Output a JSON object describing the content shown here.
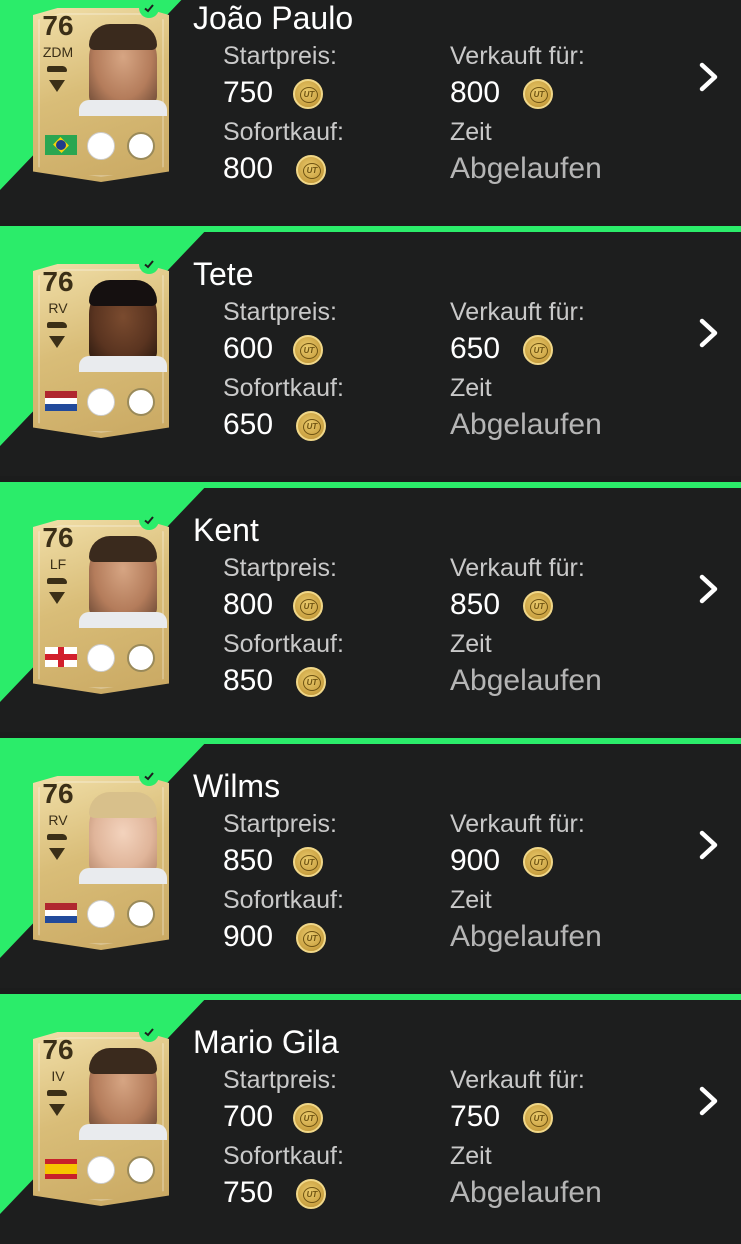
{
  "labels": {
    "start_price": "Startpreis:",
    "buy_now": "Sofortkauf:",
    "sold_for": "Verkauft für:",
    "time": "Zeit",
    "expired": "Abgelaufen"
  },
  "coin_text": "UT",
  "items": [
    {
      "name": "João Paulo",
      "rating": "76",
      "position": "ZDM",
      "start_price": "750",
      "buy_now": "800",
      "sold_for": "800"
    },
    {
      "name": "Tete",
      "rating": "76",
      "position": "RV",
      "start_price": "600",
      "buy_now": "650",
      "sold_for": "650"
    },
    {
      "name": "Kent",
      "rating": "76",
      "position": "LF",
      "start_price": "800",
      "buy_now": "850",
      "sold_for": "850"
    },
    {
      "name": "Wilms",
      "rating": "76",
      "position": "RV",
      "start_price": "850",
      "buy_now": "900",
      "sold_for": "900"
    },
    {
      "name": "Mario Gila",
      "rating": "76",
      "position": "IV",
      "start_price": "700",
      "buy_now": "750",
      "sold_for": "750"
    }
  ],
  "colors": {
    "accent": "#2bec6a",
    "background": "#1d1e1e",
    "card_gold": "#d9bd78",
    "text": "#ffffff",
    "muted": "#b5b5b5"
  }
}
